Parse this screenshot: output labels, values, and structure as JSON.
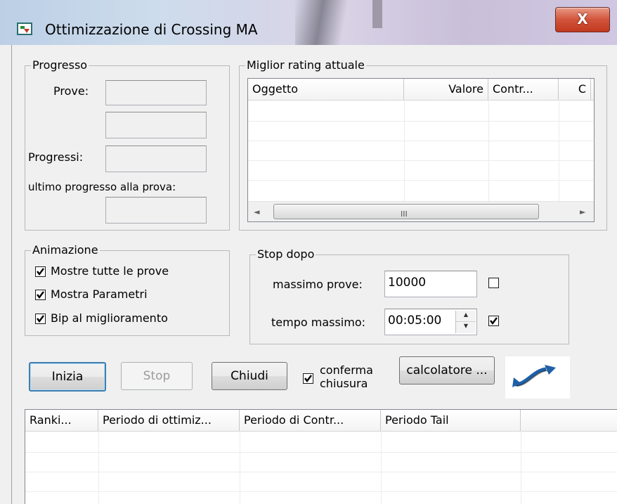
{
  "window": {
    "title": "Ottimizzazione di Crossing MA",
    "close_label": "X"
  },
  "progresso": {
    "title": "Progresso",
    "prove_label": "Prove:",
    "progressi_label": "Progressi:",
    "ultimo_label": "ultimo progresso alla prova:",
    "prove_value": "",
    "extra_value": "",
    "progressi_value": "",
    "ultimo_value": ""
  },
  "miglior_rating": {
    "title": "Miglior rating attuale",
    "columns": [
      "Oggetto",
      "Valore",
      "Contr...",
      "C"
    ],
    "rows": [],
    "scroll_grip": "III",
    "scroll_left": "◄",
    "scroll_right": "►"
  },
  "animazione": {
    "title": "Animazione",
    "items": [
      {
        "label": "Mostre tutte le prove",
        "checked": true
      },
      {
        "label": "Mostra Parametri",
        "checked": true
      },
      {
        "label": "Bip al miglioramento",
        "checked": true
      }
    ]
  },
  "stop_dopo": {
    "title": "Stop dopo",
    "massimo_prove_label": "massimo prove:",
    "massimo_prove_value": "10000",
    "massimo_prove_checked": false,
    "tempo_massimo_label": "tempo massimo:",
    "tempo_massimo_value": "00:05:00",
    "tempo_massimo_checked": true
  },
  "buttons": {
    "inizia": "Inizia",
    "stop": "Stop",
    "chiudi": "Chiudi",
    "calcolatore": "calcolatore ..."
  },
  "conferma": {
    "label_line1": "conferma",
    "label_line2": "chiusura",
    "checked": true
  },
  "results": {
    "columns": [
      "Ranki...",
      "Periodo di ottimiz...",
      "Periodo di Contr...",
      "Periodo Tail",
      ""
    ],
    "rows": []
  },
  "colors": {
    "accent": "#3c7fb1",
    "logo_blue": "#1f5fa8",
    "close_red": "#c0391f"
  },
  "icons": [
    "app-icon",
    "close-icon",
    "checkmark-icon",
    "spinner-up-icon",
    "spinner-down-icon",
    "crossing-logo-icon"
  ]
}
